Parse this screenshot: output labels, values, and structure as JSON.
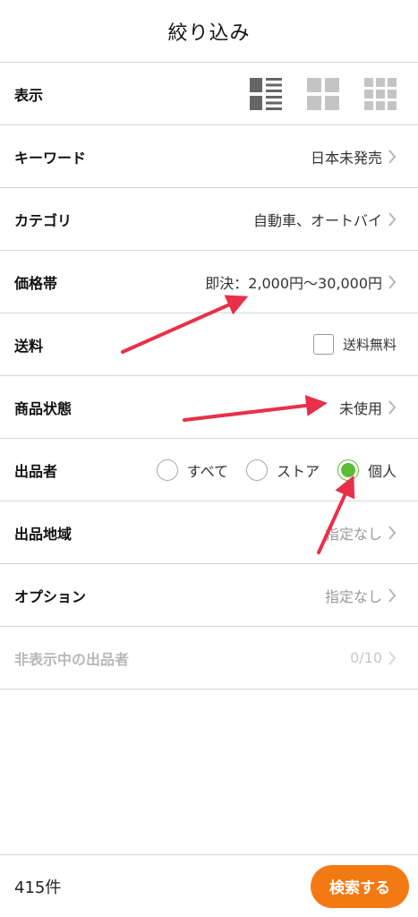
{
  "header": {
    "title": "絞り込み"
  },
  "rows": {
    "display": {
      "label": "表示"
    },
    "keyword": {
      "label": "キーワード",
      "value": "日本未発売"
    },
    "category": {
      "label": "カテゴリ",
      "value": "自動車、オートバイ"
    },
    "price": {
      "label": "価格帯",
      "value": "即決：2,000円〜30,000円"
    },
    "shipping": {
      "label": "送料",
      "checkbox_label": "送料無料",
      "checked": false
    },
    "condition": {
      "label": "商品状態",
      "value": "未使用"
    },
    "seller": {
      "label": "出品者",
      "options": [
        "すべて",
        "ストア",
        "個人"
      ],
      "selected": "個人"
    },
    "region": {
      "label": "出品地域",
      "value": "指定なし"
    },
    "options": {
      "label": "オプション",
      "value": "指定なし"
    },
    "hidden_sellers": {
      "label": "非表示中の出品者",
      "value": "0/10"
    }
  },
  "footer": {
    "count": "415件",
    "search_label": "検索する"
  },
  "colors": {
    "accent": "#f37a13",
    "radio_selected": "#5cbc36",
    "annotation_arrow": "#e8304a"
  },
  "icons": [
    "list-view-icon",
    "grid-view-icon",
    "small-grid-view-icon",
    "chevron-right-icon",
    "arrow-annotation"
  ]
}
